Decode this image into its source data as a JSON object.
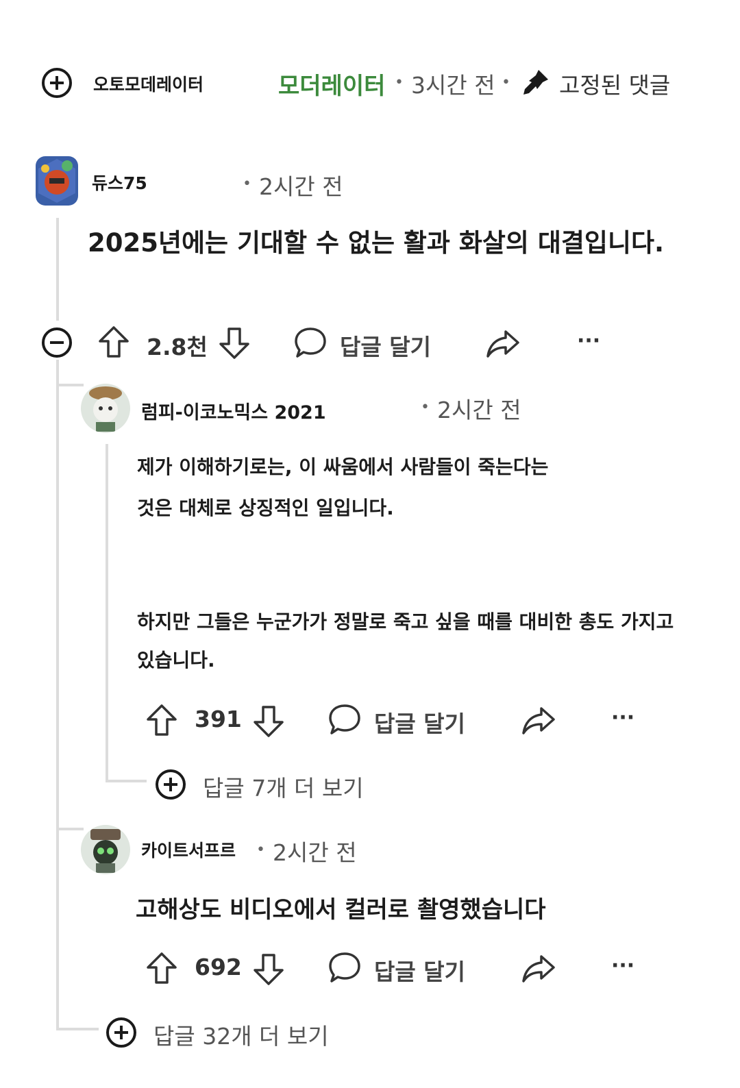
{
  "pinned": {
    "username": "오토모데레이터",
    "role": "모더레이터",
    "time": "3시간 전",
    "pinned_label": "고정된 댓글",
    "role_color": "#3c8a3c"
  },
  "comment": {
    "username": "듀스75",
    "time": "2시간 전",
    "text": "2025년에는 기대할 수 없는 활과 화살의 대결입니다.",
    "votes": "2.8천",
    "reply_label": "답글 달기"
  },
  "reply1": {
    "username": "럼피-이코노믹스 2021",
    "time": "2시간 전",
    "line1": "제가 이해하기로는, 이 싸움에서 사람들이 죽는다는",
    "line2": "것은 대체로 상징적인 일입니다.",
    "line3": "하지만 그들은 누군가가 정말로 죽고 싶을 때를 대비한 총도 가지고",
    "line4": "있습니다.",
    "votes": "391",
    "reply_label": "답글 달기",
    "more_replies": "답글 7개 더 보기"
  },
  "reply2": {
    "username": "카이트서프르",
    "time": "2시간 전",
    "text": "고해상도 비디오에서 컬러로 촬영했습니다",
    "votes": "692",
    "reply_label": "답글 달기"
  },
  "more_replies": "답글 32개 더 보기",
  "separator": "•",
  "more_icon_text": "···"
}
